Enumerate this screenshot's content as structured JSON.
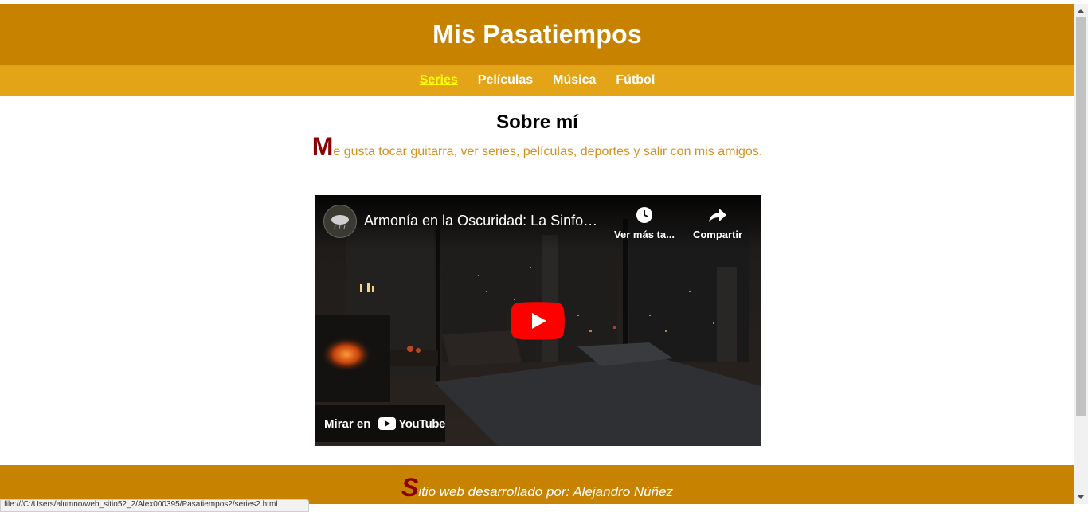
{
  "header": {
    "title": "Mis Pasatiempos"
  },
  "nav": {
    "items": [
      {
        "label": "Series",
        "active": true
      },
      {
        "label": "Películas",
        "active": false
      },
      {
        "label": "Música",
        "active": false
      },
      {
        "label": "Fútbol",
        "active": false
      }
    ]
  },
  "about": {
    "title": "Sobre mí",
    "dropcap": "M",
    "text": "e gusta tocar guitarra, ver series, películas, deportes y salir con mis amigos."
  },
  "video": {
    "title": "Armonía en la Oscuridad: La Sinfoní...",
    "watch_later": "Ver más ta...",
    "share": "Compartir",
    "watch_on": "Mirar en",
    "brand": "YouTube"
  },
  "footer": {
    "dropcap": "S",
    "text": "itio web desarrollado por: Alejandro Núñez"
  },
  "status_bar": {
    "url": "file:///C:/Users/alumno/web_sitio52_2/Alex000395/Pasatiempos2/series2.html"
  },
  "colors": {
    "header_bg": "#c78200",
    "nav_bg": "#e3a418",
    "nav_active": "#ffff00",
    "dropcap": "#8b0000",
    "text_accent": "#d4901f"
  }
}
